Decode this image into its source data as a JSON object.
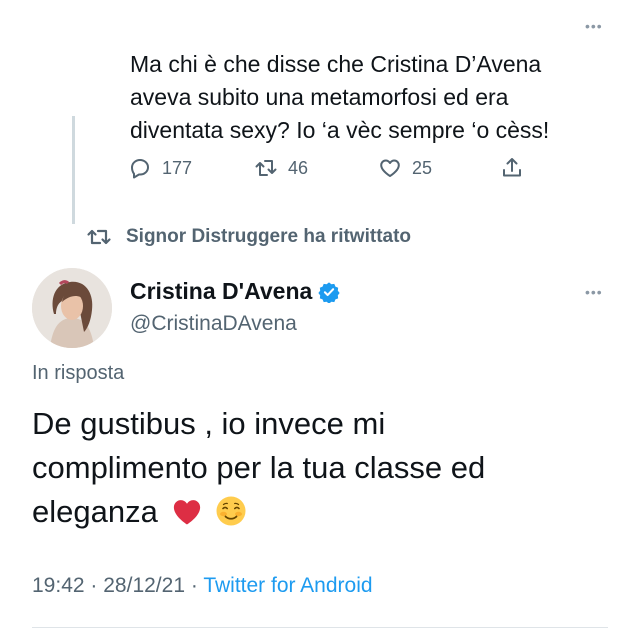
{
  "previous_tweet": {
    "text_lines": [
      "Ma chi è che disse che Cristina D’Avena",
      "aveva subito una metamorfosi ed era",
      "diventata sexy? Io ‘a vèc sempre ‘o cèss!"
    ],
    "replies": "177",
    "retweets": "46",
    "likes": "25"
  },
  "retweet_notice": "Signor Distruggere ha ritwittato",
  "tweet": {
    "display_name": "Cristina D'Avena",
    "handle": "@CristinaDAvena",
    "reply_label": "In risposta",
    "text_lines": [
      "De gustibus , io invece mi",
      "complimento per la tua classe ed",
      "eleganza"
    ],
    "emojis": [
      "❤️",
      "☺️"
    ],
    "time": "19:42",
    "date": "28/12/21",
    "separator": "·",
    "source": "Twitter for Android"
  },
  "icons": {
    "reply": "reply-icon",
    "retweet": "retweet-icon",
    "like": "heart-icon",
    "share": "share-icon",
    "verified": "verified-badge-icon",
    "more": "more-options-icon"
  },
  "colors": {
    "link": "#1d9bf0",
    "secondary_text": "#536471",
    "heart": "#e0245e"
  }
}
